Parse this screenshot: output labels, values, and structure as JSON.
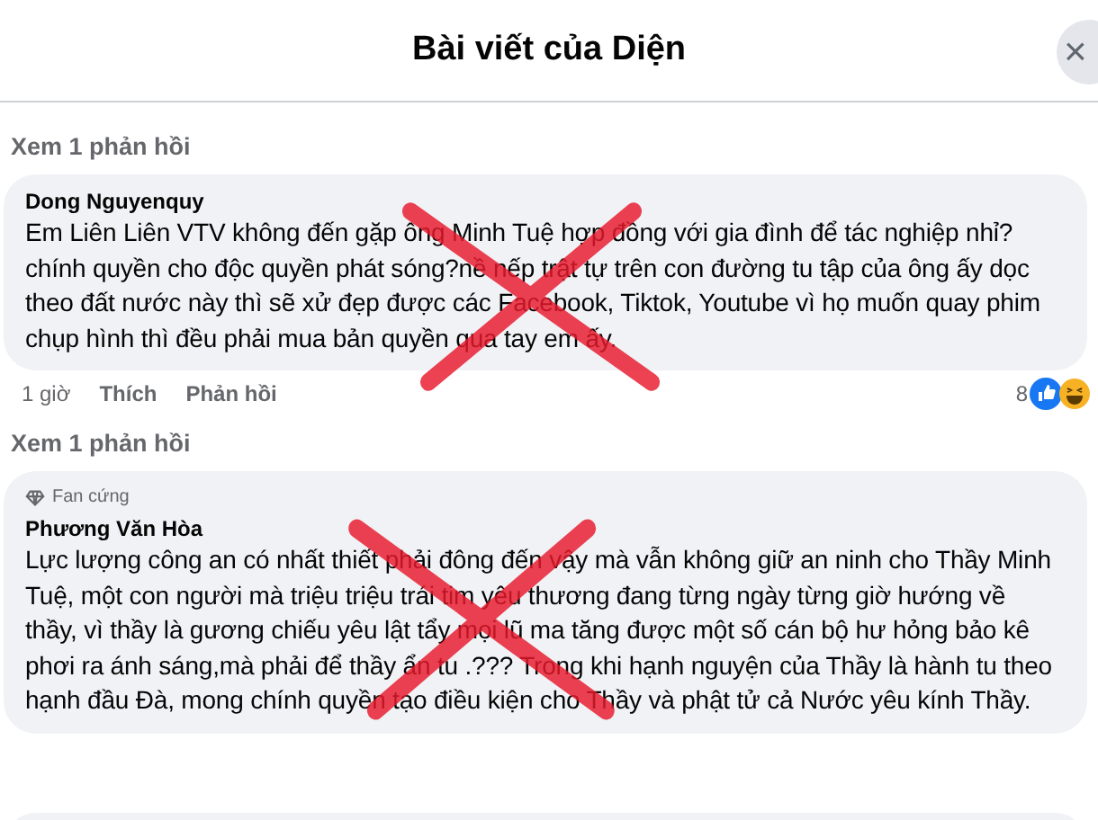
{
  "dialog": {
    "title": "Bài viết của Diện",
    "close": "×"
  },
  "thread": [
    {
      "kind": "link",
      "text": "Xem 1 phản hồi"
    },
    {
      "kind": "comment",
      "author": "Dong Nguyenquy",
      "text": "Em Liên Liên VTV không đến gặp ông Minh Tuệ hợp đồng với gia đình để tác nghiệp nhỉ?chính quyền cho độc quyền phát sóng?nề nếp trật tự trên con đường tu tập của ông ấy dọc theo đất nước này thì sẽ xử đẹp được các Facebook, Tiktok, Youtube vì họ muốn quay phim chụp hình thì đều phải mua bản quyền qua tay em ấy.",
      "crossed_out": true,
      "time": "1 giờ",
      "actions": [
        "Thích",
        "Phản hồi"
      ],
      "reaction_count": "8"
    },
    {
      "kind": "link",
      "text": "Xem 1 phản hồi"
    },
    {
      "kind": "comment",
      "badge": "Fan cứng",
      "author": "Phương Văn Hòa",
      "text": "Lực lượng công an có nhất thiết phải đông đến vậy mà vẫn không giữ an ninh cho Thầy Minh Tuệ, một con người mà triệu triệu trái tim yêu thương đang từng ngày từng giờ hướng về thầy, vì thầy là gương chiếu yêu lật tẩy mọi lũ ma tăng được một số cán bộ hư hỏng bảo kê phơi ra ánh sáng,mà phải để thầy ẩn tu .??? Trong khi hạnh nguyện của Thầy là hành tu theo hạnh đầu Đà, mong chính quyền tạo điều kiện cho Thầy và phật tử cả Nước yêu kính Thầy.",
      "crossed_out": true
    }
  ]
}
